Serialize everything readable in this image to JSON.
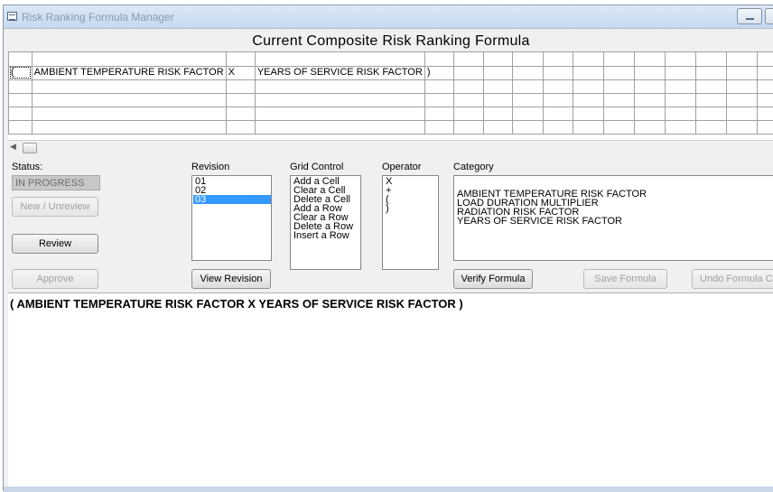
{
  "window": {
    "title": "Risk Ranking Formula Manager"
  },
  "grid": {
    "title": "Current Composite Risk Ranking Formula",
    "row1": [
      "(",
      "AMBIENT TEMPERATURE RISK FACTOR",
      "X",
      "YEARS OF SERVICE RISK FACTOR",
      ")"
    ]
  },
  "status": {
    "label": "Status:",
    "value": "IN PROGRESS"
  },
  "buttons": {
    "new_unreview": "New / Unreview",
    "review": "Review",
    "approve": "Approve",
    "view_revision": "View Revision",
    "verify_formula": "Verify Formula",
    "save_formula": "Save Formula",
    "undo_formula": "Undo Formula C"
  },
  "revision": {
    "label": "Revision",
    "items": [
      "01",
      "02",
      "03"
    ],
    "selected": "03"
  },
  "grid_control": {
    "label": "Grid Control",
    "items": [
      "Add a Cell",
      "Clear a Cell",
      "Delete a Cell",
      "Add a Row",
      "Clear a Row",
      "Delete a Row",
      "Insert a Row"
    ]
  },
  "operator": {
    "label": "Operator",
    "items": [
      "X",
      "+",
      "(",
      ")"
    ]
  },
  "category": {
    "label": "Category",
    "items": [
      "AMBIENT TEMPERATURE RISK FACTOR",
      "LOAD DURATION MULTIPLIER",
      "RADIATION RISK FACTOR",
      "YEARS OF SERVICE RISK FACTOR"
    ]
  },
  "formula_text": "( AMBIENT TEMPERATURE RISK FACTOR X YEARS OF SERVICE RISK FACTOR )"
}
